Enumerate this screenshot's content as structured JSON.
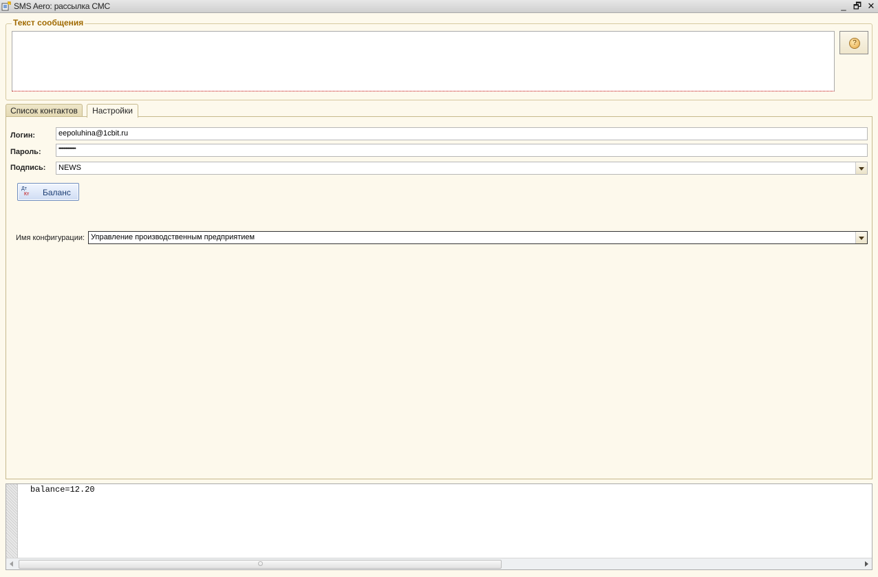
{
  "window": {
    "title": "SMS Aero: рассылка СМС",
    "minimize_glyph": "_",
    "restore_glyph": "🗗",
    "close_glyph": "✕"
  },
  "message_group": {
    "legend": "Текст сообщения",
    "text_value": "",
    "help_glyph": "?"
  },
  "tabs": [
    {
      "label": "Список контактов",
      "active": false
    },
    {
      "label": "Настройки",
      "active": true
    }
  ],
  "settings": {
    "login_label": "Логин:",
    "login_value": "eepoluhina@1cbit.ru",
    "password_label": "Пароль:",
    "password_value": "•••••••••••••••••",
    "signature_label": "Подпись:",
    "signature_value": "NEWS",
    "balance_button": "Баланс",
    "balance_icon_top": "Дт",
    "balance_icon_bottom": "Кт",
    "config_label": "Имя конфигурации:",
    "config_value": "Управление производственным предприятием"
  },
  "output": {
    "text": "balance=12.20"
  }
}
